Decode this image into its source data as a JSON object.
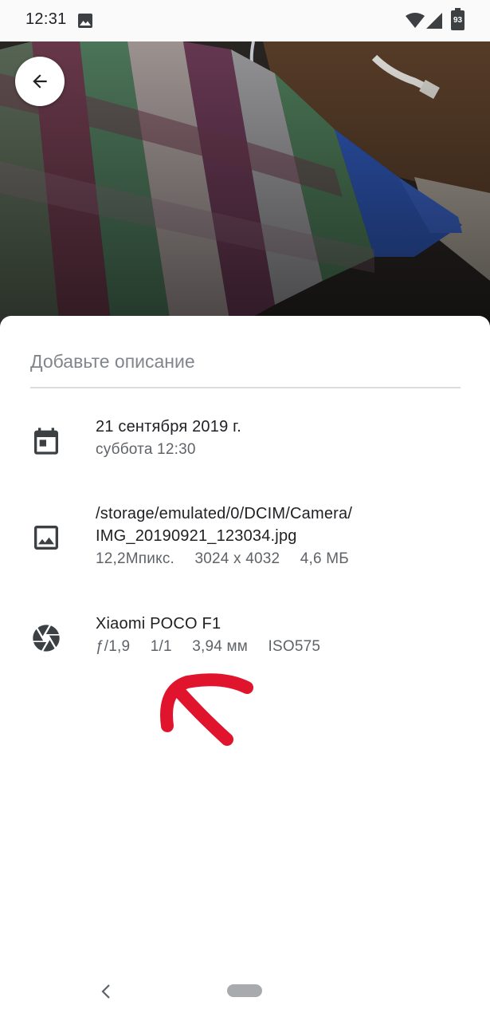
{
  "status_bar": {
    "time": "12:31",
    "battery": "93",
    "icons": [
      "gallery-icon",
      "wifi-icon",
      "signal-icon",
      "battery-icon"
    ]
  },
  "photo_header": {
    "back_icon": "arrow-left-icon"
  },
  "details": {
    "description_placeholder": "Добавьте описание",
    "date": {
      "icon": "calendar-icon",
      "primary": "21 сентября 2019 г.",
      "secondary": "суббота 12:30"
    },
    "file": {
      "icon": "image-icon",
      "path_line1": "/storage/emulated/0/DCIM/Camera/",
      "path_line2": "IMG_20190921_123034.jpg",
      "megapixels": "12,2Мпикс.",
      "resolution": "3024 x 4032",
      "size": "4,6 МБ"
    },
    "camera": {
      "icon": "aperture-icon",
      "model": "Xiaomi POCO F1",
      "aperture": "ƒ/1,9",
      "exposure": "1/1",
      "focal_length": "3,94 мм",
      "iso": "ISO575"
    }
  },
  "colors": {
    "annotation": "#e0142d",
    "primary_text": "#202124",
    "secondary_text": "#5f6368",
    "divider": "#dadce0"
  },
  "nav_bar": {
    "back_icon": "chevron-left-icon",
    "home_icon": "home-pill-icon"
  }
}
